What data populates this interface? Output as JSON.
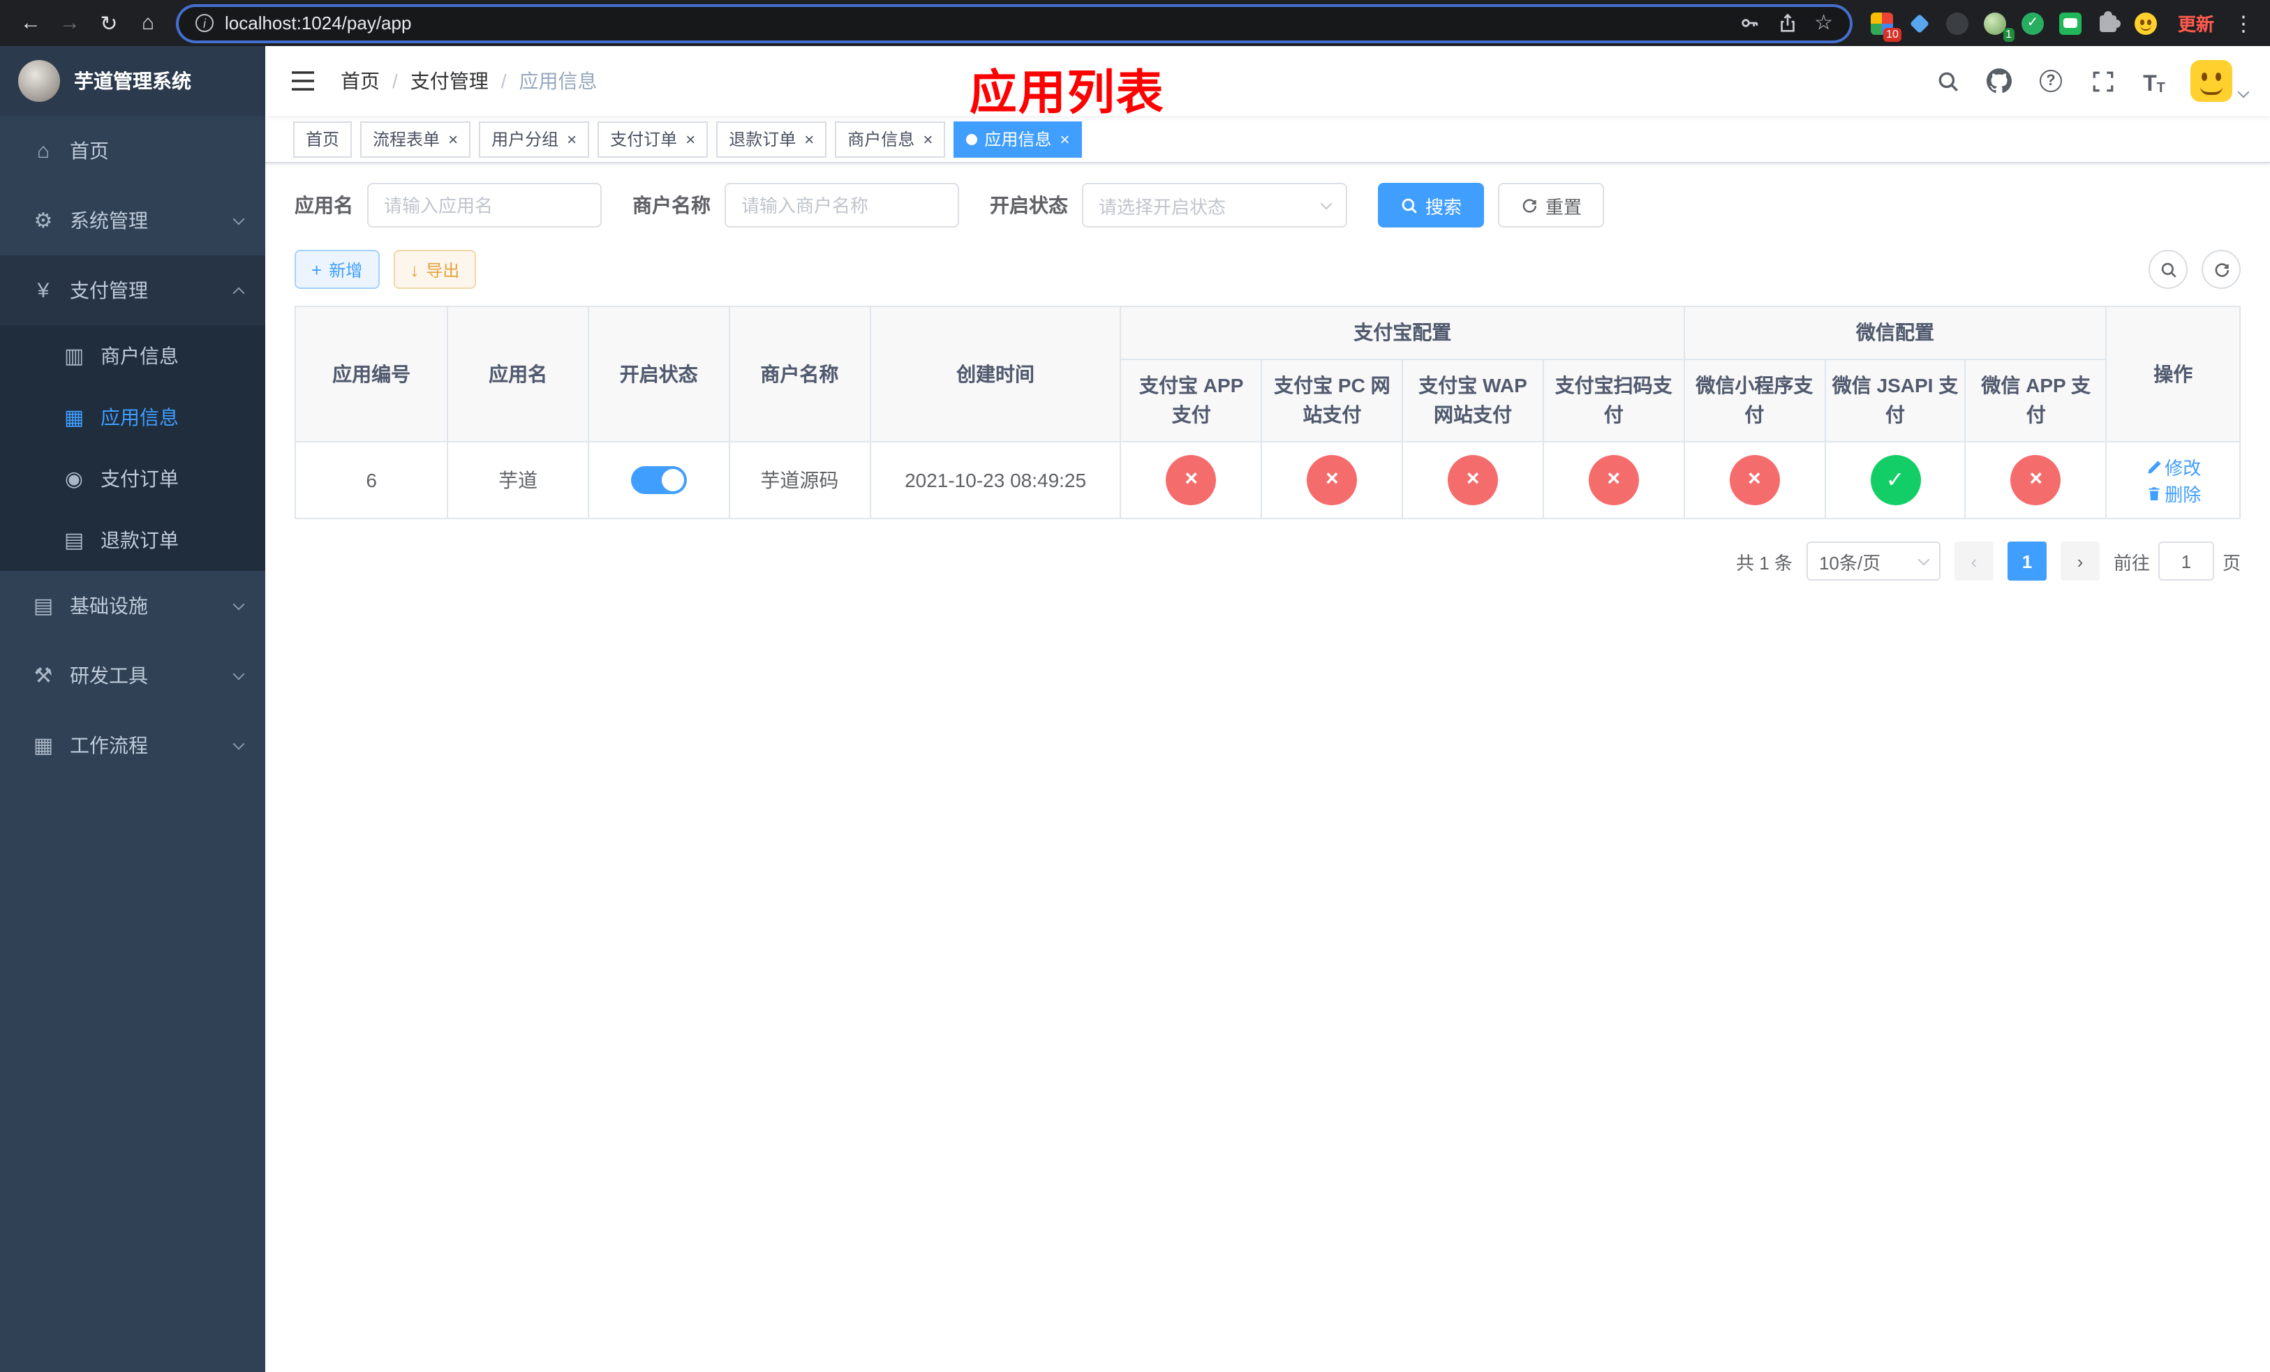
{
  "browser": {
    "url": "localhost:1024/pay/app",
    "update_label": "更新",
    "badges": {
      "ext1": "10",
      "ext4": "1"
    }
  },
  "glyphs": {
    "back": "←",
    "forward": "→",
    "reload": "↻",
    "home": "⌂",
    "info": "i",
    "star": "☆",
    "kebab": "⋮",
    "slash": "/",
    "close": "×",
    "check": "✓",
    "prev": "‹",
    "next": "›",
    "question": "?",
    "font_big": "T",
    "font_small": "T",
    "plus": "+",
    "download": "↓",
    "menu_home": "⌂",
    "menu_system": "⚙",
    "menu_pay": "¥",
    "menu_infra": "▤",
    "menu_dev": "⚒",
    "menu_flow": "▦",
    "menu_merchant": "▥",
    "menu_app": "▦",
    "menu_order": "◉",
    "menu_refund": "▤"
  },
  "sidebar": {
    "title": "芋道管理系统",
    "items": [
      {
        "label": "首页"
      },
      {
        "label": "系统管理"
      },
      {
        "label": "支付管理"
      },
      {
        "label": "基础设施"
      },
      {
        "label": "研发工具"
      },
      {
        "label": "工作流程"
      }
    ],
    "payment_children": [
      {
        "label": "商户信息"
      },
      {
        "label": "应用信息"
      },
      {
        "label": "支付订单"
      },
      {
        "label": "退款订单"
      }
    ]
  },
  "header": {
    "breadcrumb": [
      "首页",
      "支付管理",
      "应用信息"
    ],
    "annotation": "应用列表"
  },
  "tabs": {
    "items": [
      {
        "label": "首页"
      },
      {
        "label": "流程表单"
      },
      {
        "label": "用户分组"
      },
      {
        "label": "支付订单"
      },
      {
        "label": "退款订单"
      },
      {
        "label": "商户信息"
      },
      {
        "label": "应用信息"
      }
    ]
  },
  "filters": {
    "fields": [
      {
        "label": "应用名",
        "placeholder": "请输入应用名"
      },
      {
        "label": "商户名称",
        "placeholder": "请输入商户名称"
      },
      {
        "label": "开启状态",
        "placeholder": "请选择开启状态"
      }
    ],
    "search_label": "搜索",
    "reset_label": "重置"
  },
  "toolbar": {
    "add_label": "新增",
    "export_label": "导出"
  },
  "table": {
    "groups": {
      "alipay": "支付宝配置",
      "wechat": "微信配置"
    },
    "columns": [
      "应用编号",
      "应用名",
      "开启状态",
      "商户名称",
      "创建时间",
      "支付宝 APP 支付",
      "支付宝 PC 网站支付",
      "支付宝 WAP 网站支付",
      "支付宝扫码支付",
      "微信小程序支付",
      "微信 JSAPI 支付",
      "微信 APP 支付",
      "操作"
    ],
    "rows": [
      {
        "id": "6",
        "name": "芋道",
        "status": "on",
        "merchant": "芋道源码",
        "created": "2021-10-23 08:49:25",
        "channels": [
          "fail",
          "fail",
          "fail",
          "fail",
          "fail",
          "success",
          "fail"
        ],
        "edit_label": "修改",
        "delete_label": "删除"
      }
    ]
  },
  "pagination": {
    "total": "共 1 条",
    "page_size": "10条/页",
    "page": "1",
    "goto_prefix": "前往",
    "goto_suffix": "页",
    "goto_value": "1"
  },
  "colors": {
    "primary": "#409eff",
    "success": "#13ce66",
    "danger": "#f56c6c",
    "warning": "#e6a23c",
    "sidebar_bg": "#304156",
    "submenu_bg": "#1f2d3d",
    "annotation_red": "#ff0000",
    "update_red": "#ff5a4e"
  }
}
